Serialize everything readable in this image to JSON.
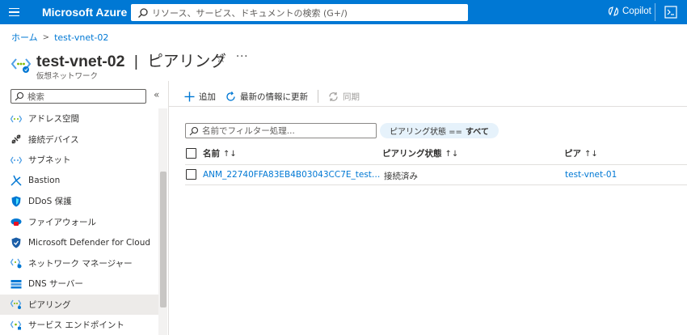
{
  "topbar": {
    "brand": "Microsoft Azure",
    "search_placeholder": "リソース、サービス、ドキュメントの検索 (G+/)",
    "copilot_label": "Copilot",
    "accent": "#0078d4"
  },
  "breadcrumb": {
    "home": "ホーム",
    "current": "test-vnet-02",
    "separator": ">"
  },
  "header": {
    "resource_name": "test-vnet-02",
    "divider": "|",
    "page": "ピアリング",
    "subtitle": "仮想ネットワーク",
    "favorite_icon": "☆",
    "more_label": "···"
  },
  "sidebar": {
    "search_placeholder": "検索",
    "collapse_label": "«",
    "items": [
      {
        "label": "アドレス空間",
        "icon": "address-space-icon"
      },
      {
        "label": "接続デバイス",
        "icon": "connected-devices-icon"
      },
      {
        "label": "サブネット",
        "icon": "subnet-icon"
      },
      {
        "label": "Bastion",
        "icon": "bastion-icon"
      },
      {
        "label": "DDoS 保護",
        "icon": "ddos-shield-icon"
      },
      {
        "label": "ファイアウォール",
        "icon": "firewall-icon"
      },
      {
        "label": "Microsoft Defender for Cloud",
        "icon": "defender-icon"
      },
      {
        "label": "ネットワーク マネージャー",
        "icon": "network-manager-icon"
      },
      {
        "label": "DNS サーバー",
        "icon": "dns-server-icon"
      },
      {
        "label": "ピアリング",
        "icon": "peering-icon",
        "active": true
      },
      {
        "label": "サービス エンドポイント",
        "icon": "service-endpoint-icon"
      }
    ]
  },
  "toolbar": {
    "add_label": "追加",
    "refresh_label": "最新の情報に更新",
    "sync_label": "同期"
  },
  "filter": {
    "placeholder": "名前でフィルター処理...",
    "pill_key": "ピアリング状態 ==",
    "pill_value": "すべて"
  },
  "table": {
    "columns": [
      "名前",
      "ピアリング状態",
      "ピア"
    ],
    "sort_glyph": "↑↓",
    "rows": [
      {
        "name": "ANM_22740FFA83EB4B03043CC7E_test…",
        "status": "接続済み",
        "peer": "test-vnet-01"
      }
    ]
  }
}
